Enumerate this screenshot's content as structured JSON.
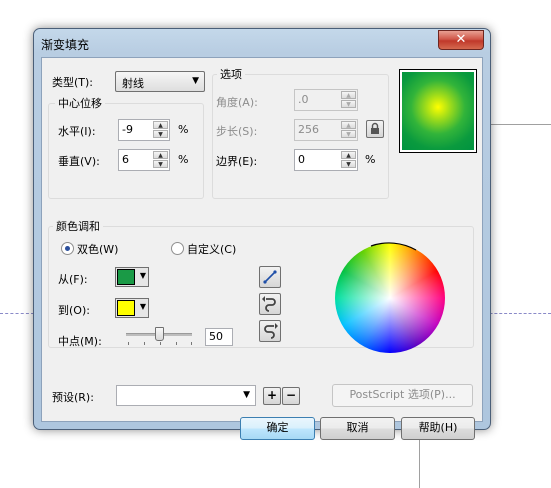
{
  "window": {
    "title": "渐变填充",
    "close_glyph": "✕"
  },
  "type": {
    "label": "类型(T):",
    "value": "射线"
  },
  "center_offset": {
    "title": "中心位移",
    "horizontal_label": "水平(I):",
    "horizontal_value": "-9",
    "vertical_label": "垂直(V):",
    "vertical_value": "6",
    "unit": "%"
  },
  "options": {
    "title": "选项",
    "angle_label": "角度(A):",
    "angle_value": ".0",
    "steps_label": "步长(S):",
    "steps_value": "256",
    "edge_label": "边界(E):",
    "edge_value": "0",
    "unit": "%"
  },
  "color_blend": {
    "title": "颜色调和",
    "two_color_label": "双色(W)",
    "custom_label": "自定义(C)",
    "from_label": "从(F):",
    "from_color": "#1a9a46",
    "to_label": "到(O):",
    "to_color": "#ffff00",
    "midpoint_label": "中点(M):",
    "midpoint_value": "50",
    "midpoint_fraction": 0.5
  },
  "preset": {
    "label": "预设(R):",
    "value": "",
    "plus": "+",
    "minus": "−"
  },
  "postscript_label": "PostScript 选项(P)...",
  "buttons": {
    "ok": "确定",
    "cancel": "取消",
    "help": "帮助(H)"
  }
}
